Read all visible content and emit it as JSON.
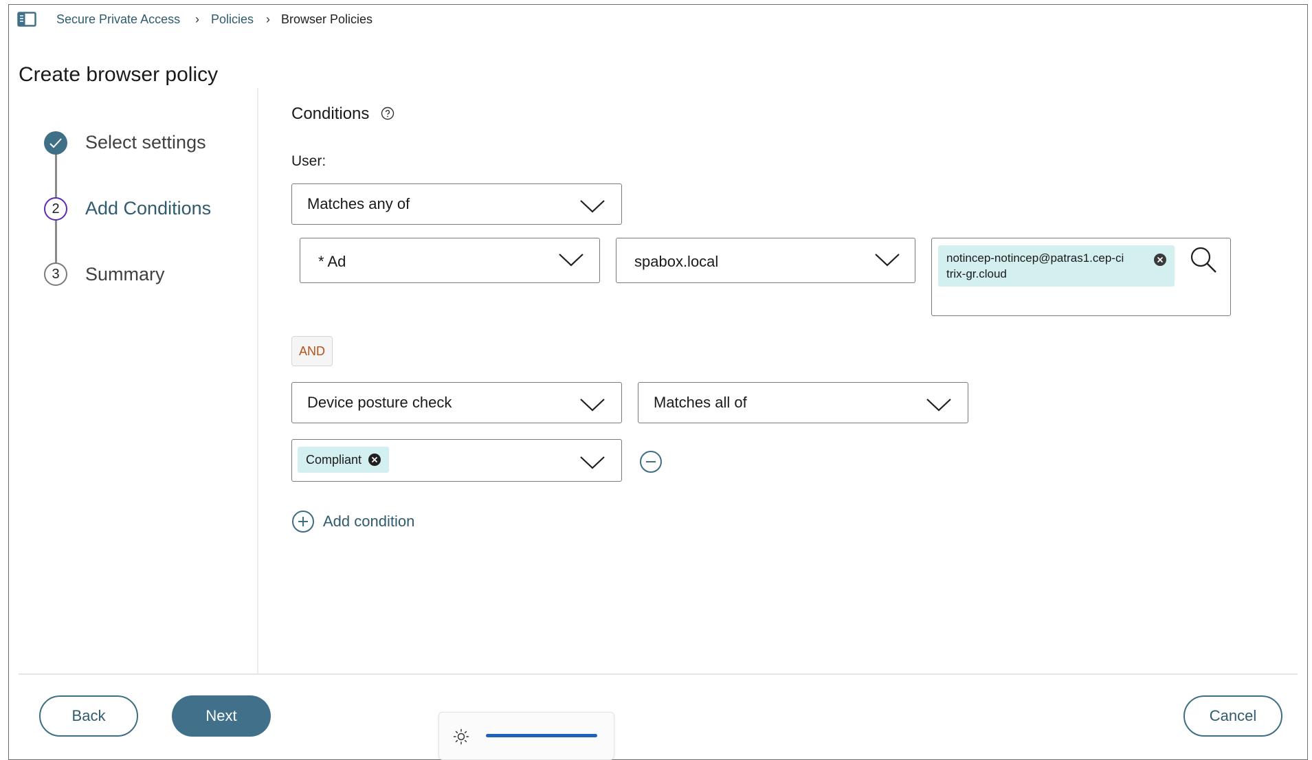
{
  "breadcrumb": {
    "items": [
      "Secure Private Access",
      "Policies",
      "Browser Policies"
    ],
    "separator": "›"
  },
  "page_title": "Create browser policy",
  "stepper": {
    "steps": [
      {
        "number": "1",
        "label": "Select settings",
        "state": "completed"
      },
      {
        "number": "2",
        "label": "Add Conditions",
        "state": "active"
      },
      {
        "number": "3",
        "label": "Summary",
        "state": "pending"
      }
    ]
  },
  "conditions": {
    "title": "Conditions",
    "user_label": "User:",
    "user_match_select": "Matches any of",
    "directory_select": "* Ad",
    "domain_select": "spabox.local",
    "user_chip": {
      "line1": "notincep-notincep@patras1.cep-ci",
      "line2": "trix-gr.cloud"
    },
    "operator_badge": "AND",
    "posture_select": "Device posture check",
    "posture_match_select": "Matches all of",
    "posture_value_chip": "Compliant",
    "add_condition_label": "Add condition"
  },
  "footer": {
    "back_label": "Back",
    "next_label": "Next",
    "cancel_label": "Cancel"
  },
  "brightness": {
    "level": 1.0
  },
  "colors": {
    "accent": "#41708a",
    "link": "#2f5b6e",
    "active_step_ring": "#5b2bb6",
    "chip_bg": "#d3efef",
    "and_text": "#b5521b",
    "slider": "#1c63b9"
  },
  "icons": [
    "sidebar-toggle-icon",
    "help-icon",
    "checkmark-icon",
    "chevron-down-icon",
    "remove-chip-icon",
    "search-icon",
    "remove-condition-icon",
    "add-condition-icon",
    "brightness-icon"
  ]
}
